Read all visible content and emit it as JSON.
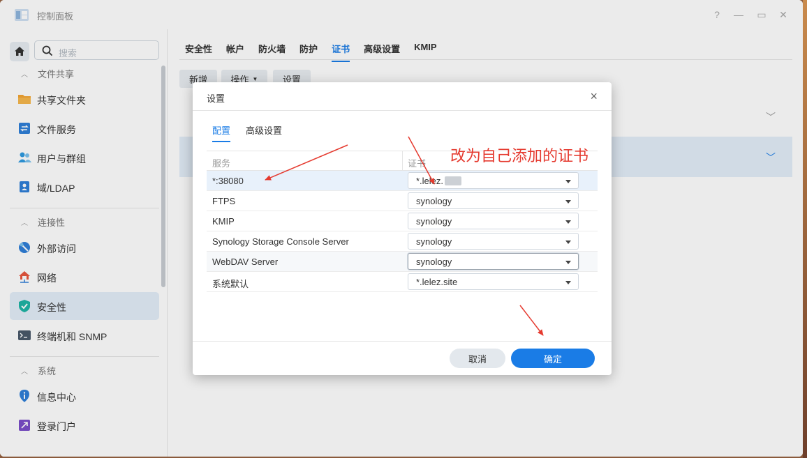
{
  "window": {
    "title": "控制面板",
    "controls": [
      "?",
      "—",
      "▭",
      "✕"
    ]
  },
  "sidebar": {
    "search_placeholder": "搜索",
    "sections": [
      {
        "label": "文件共享"
      },
      {
        "label": "连接性"
      },
      {
        "label": "系统"
      }
    ],
    "items": [
      {
        "label": "共享文件夹",
        "icon": "folder-icon"
      },
      {
        "label": "文件服务",
        "icon": "file-services-icon"
      },
      {
        "label": "用户与群组",
        "icon": "users-icon"
      },
      {
        "label": "域/LDAP",
        "icon": "ldap-icon"
      },
      {
        "label": "外部访问",
        "icon": "external-access-icon"
      },
      {
        "label": "网络",
        "icon": "network-icon"
      },
      {
        "label": "安全性",
        "icon": "shield-icon",
        "active": true
      },
      {
        "label": "终端机和 SNMP",
        "icon": "terminal-icon"
      },
      {
        "label": "信息中心",
        "icon": "info-icon"
      },
      {
        "label": "登录门户",
        "icon": "login-portal-icon"
      }
    ]
  },
  "main": {
    "tabs": [
      {
        "label": "安全性"
      },
      {
        "label": "帐户"
      },
      {
        "label": "防火墙"
      },
      {
        "label": "防护"
      },
      {
        "label": "证书",
        "active": true
      },
      {
        "label": "高级设置"
      },
      {
        "label": "KMIP"
      }
    ],
    "toolbar": {
      "add": "新增",
      "action": "操作",
      "settings": "设置"
    }
  },
  "dialog": {
    "title": "设置",
    "close": "×",
    "tabs": [
      {
        "label": "配置",
        "active": true
      },
      {
        "label": "高级设置"
      }
    ],
    "columns": {
      "service": "服务",
      "certificate": "证书"
    },
    "rows": [
      {
        "service": "*:38080",
        "certificate": "*.lelez.",
        "redacted": true
      },
      {
        "service": "FTPS",
        "certificate": "synology"
      },
      {
        "service": "KMIP",
        "certificate": "synology"
      },
      {
        "service": "Synology Storage Console Server",
        "certificate": "synology"
      },
      {
        "service": "WebDAV Server",
        "certificate": "synology"
      },
      {
        "service": "系统默认",
        "certificate": "*.lelez.site"
      }
    ],
    "cancel": "取消",
    "ok": "确定"
  },
  "annotation": {
    "text": "改为自己添加的证书",
    "color": "#e53a2f"
  }
}
